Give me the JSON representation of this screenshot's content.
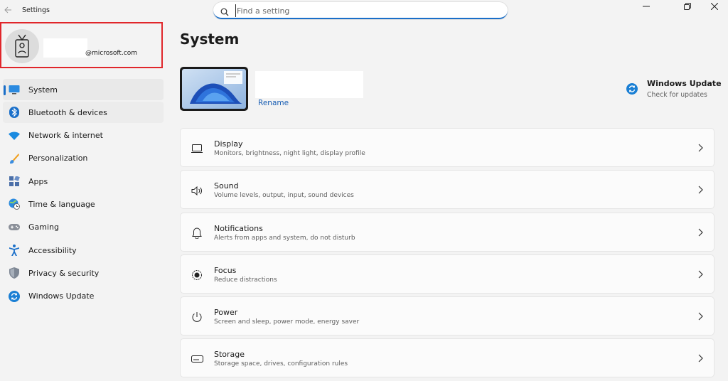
{
  "window": {
    "title": "Settings"
  },
  "search": {
    "placeholder": "Find a setting"
  },
  "account": {
    "email": "@microsoft.com"
  },
  "sidebar": {
    "items": [
      {
        "label": "System"
      },
      {
        "label": "Bluetooth & devices"
      },
      {
        "label": "Network & internet"
      },
      {
        "label": "Personalization"
      },
      {
        "label": "Apps"
      },
      {
        "label": "Time & language"
      },
      {
        "label": "Gaming"
      },
      {
        "label": "Accessibility"
      },
      {
        "label": "Privacy & security"
      },
      {
        "label": "Windows Update"
      }
    ]
  },
  "main": {
    "title": "System",
    "device": {
      "rename_label": "Rename"
    },
    "windows_update": {
      "title": "Windows Update",
      "subtitle": "Check for updates"
    },
    "cards": [
      {
        "title": "Display",
        "subtitle": "Monitors, brightness, night light, display profile",
        "icon": "display-icon"
      },
      {
        "title": "Sound",
        "subtitle": "Volume levels, output, input, sound devices",
        "icon": "sound-icon"
      },
      {
        "title": "Notifications",
        "subtitle": "Alerts from apps and system, do not disturb",
        "icon": "bell-icon"
      },
      {
        "title": "Focus",
        "subtitle": "Reduce distractions",
        "icon": "focus-icon"
      },
      {
        "title": "Power",
        "subtitle": "Screen and sleep, power mode, energy saver",
        "icon": "power-icon"
      },
      {
        "title": "Storage",
        "subtitle": "Storage space, drives, configuration rules",
        "icon": "storage-icon"
      }
    ]
  },
  "colors": {
    "accent": "#1a6fc9",
    "highlight_border": "#e0262b",
    "link": "#1a5fb4"
  }
}
